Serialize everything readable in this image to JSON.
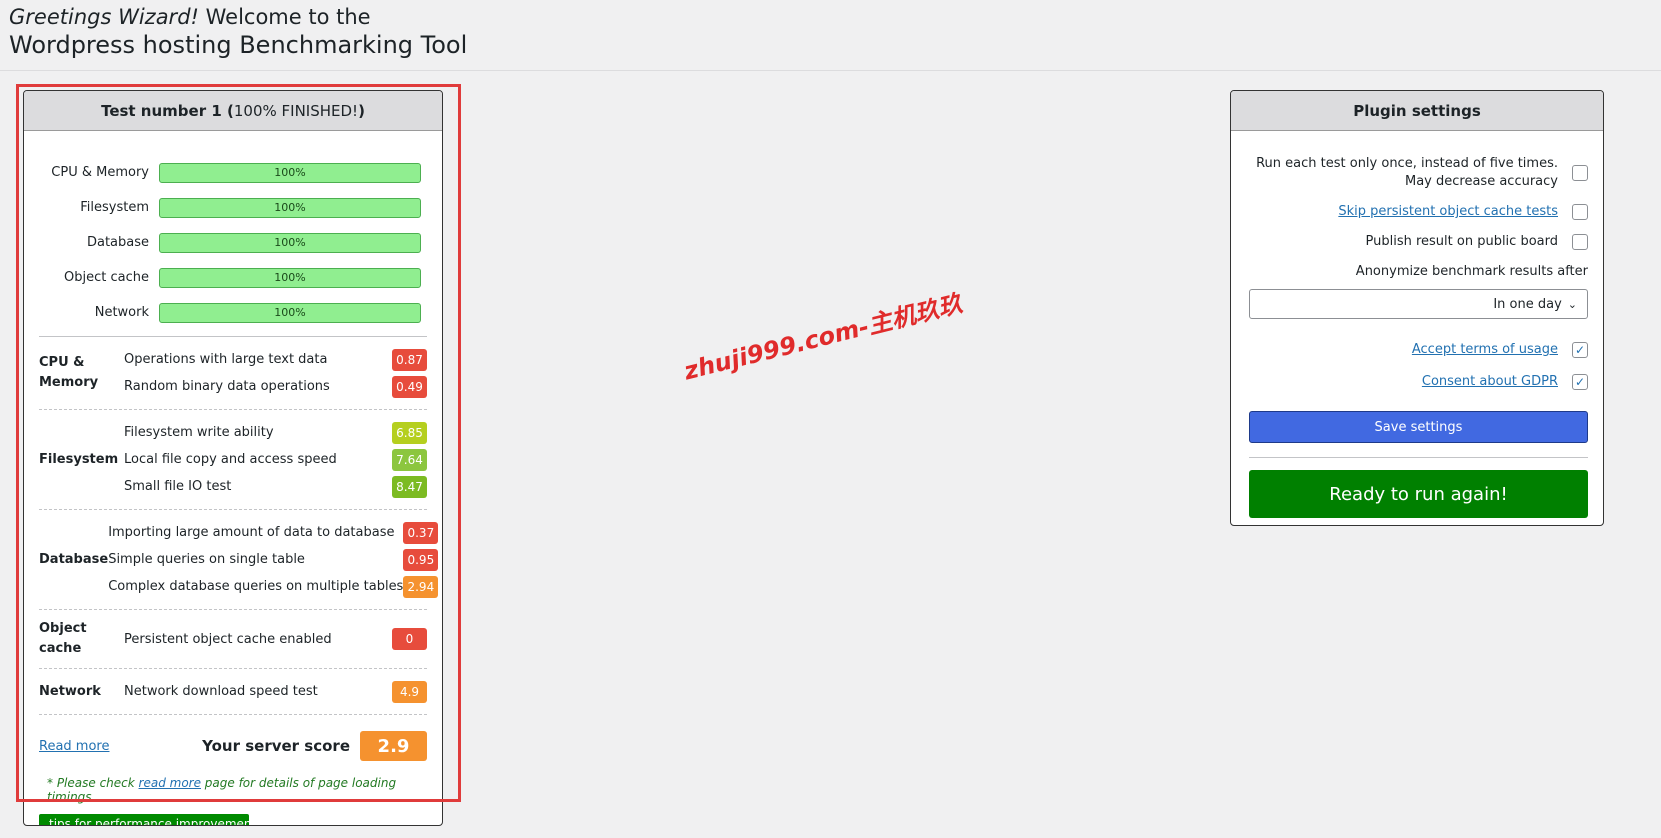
{
  "header": {
    "greeting_italic": "Greetings Wizard!",
    "greeting_rest": " Welcome to the",
    "title": "Wordpress hosting Benchmarking Tool"
  },
  "test_panel": {
    "title_bold": "Test number 1 (",
    "title_status": "100% FINISHED!",
    "title_close": ")",
    "progress": [
      {
        "label": "CPU & Memory",
        "value": "100%"
      },
      {
        "label": "Filesystem",
        "value": "100%"
      },
      {
        "label": "Database",
        "value": "100%"
      },
      {
        "label": "Object cache",
        "value": "100%"
      },
      {
        "label": "Network",
        "value": "100%"
      }
    ],
    "groups": [
      {
        "name": "CPU & Memory",
        "items": [
          {
            "label": "Operations with large text data",
            "score": "0.87",
            "color": "#e74c3c"
          },
          {
            "label": "Random binary data operations",
            "score": "0.49",
            "color": "#e74c3c"
          }
        ]
      },
      {
        "name": "Filesystem",
        "items": [
          {
            "label": "Filesystem write ability",
            "score": "6.85",
            "color": "#b5cf1f"
          },
          {
            "label": "Local file copy and access speed",
            "score": "7.64",
            "color": "#8cc63f"
          },
          {
            "label": "Small file IO test",
            "score": "8.47",
            "color": "#7cbb22"
          }
        ]
      },
      {
        "name": "Database",
        "items": [
          {
            "label": "Importing large amount of data to database",
            "score": "0.37",
            "color": "#e74c3c"
          },
          {
            "label": "Simple queries on single table",
            "score": "0.95",
            "color": "#e74c3c"
          },
          {
            "label": "Complex database queries on multiple tables",
            "score": "2.94",
            "color": "#f5922f"
          }
        ]
      },
      {
        "name": "Object cache",
        "items": [
          {
            "label": "Persistent object cache enabled",
            "score": "0",
            "color": "#e74c3c"
          }
        ]
      },
      {
        "name": "Network",
        "items": [
          {
            "label": "Network download speed test",
            "score": "4.9",
            "color": "#f5922f"
          }
        ]
      }
    ],
    "read_more": "Read more",
    "score_label": "Your server score",
    "score_value": "2.9",
    "score_color": "#f5922f",
    "note_before": "* Please check ",
    "note_link": "read more",
    "note_after": " page for details of page loading timings",
    "tips_button": "tips for performance improvement"
  },
  "settings": {
    "title": "Plugin settings",
    "run_once_line1": "Run each test only once, instead of five times.",
    "run_once_line2": "May decrease accuracy",
    "skip_cache": "Skip persistent object cache tests",
    "publish": "Publish result on public board",
    "anonymize_label": "Anonymize benchmark results after",
    "anonymize_value": "In one day",
    "accept_terms": "Accept terms of usage",
    "gdpr": "Consent about GDPR",
    "save_button": "Save settings",
    "run_button": "Ready to run again!",
    "checkmark": "✓"
  },
  "watermark": "zhuji999.com-主机玖玖"
}
